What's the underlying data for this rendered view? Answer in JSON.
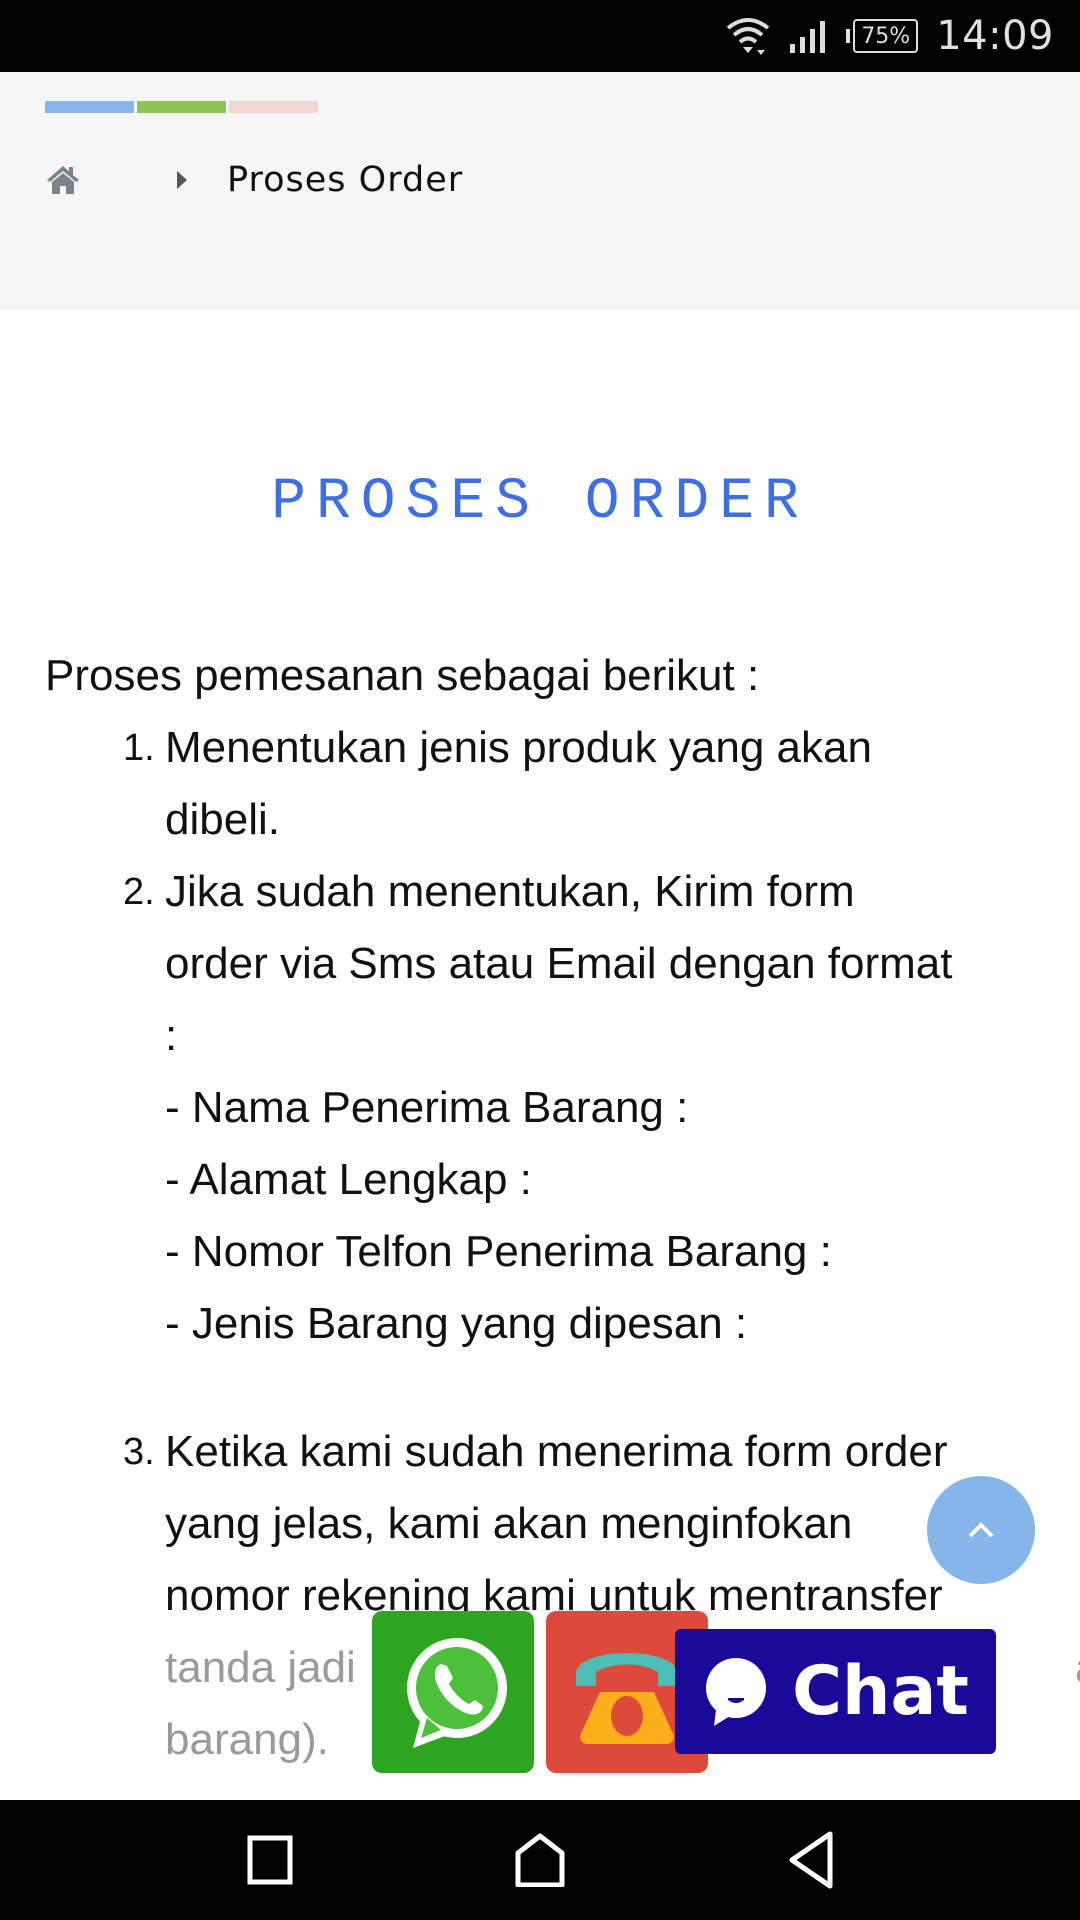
{
  "status_bar": {
    "time": "14:09",
    "battery_percent": "75%",
    "icons": [
      "wifi-icon",
      "signal-icon",
      "battery-icon"
    ]
  },
  "header": {
    "color_bars": [
      "#85b8ea",
      "#8dc453",
      "#f1d6d2"
    ],
    "breadcrumb": {
      "home_icon": "home-icon",
      "separator_icon": "caret-right-icon",
      "current": "Proses Order"
    }
  },
  "page": {
    "title": "PROSES ORDER",
    "title_color": "#3e6fe4",
    "intro": "Proses pemesanan sebagai berikut :",
    "steps": [
      {
        "number": "1.",
        "lines": [
          "Menentukan jenis produk yang akan",
          "dibeli."
        ]
      },
      {
        "number": "2.",
        "lines": [
          "Jika sudah menentukan, Kirim form",
          "order via Sms atau Email dengan format",
          ":"
        ],
        "format_fields": [
          "- Nama Penerima Barang :",
          "- Alamat Lengkap :",
          "- Nomor Telfon Penerima Barang :",
          "- Jenis Barang yang dipesan :"
        ]
      },
      {
        "number": "3.",
        "lines": [
          "Ketika kami sudah menerima form order",
          "yang jelas, kami akan menginfokan",
          "nomor rekening kami untuk mentransfer"
        ],
        "faded_lines": [
          "tanda jadi",
          "barang)."
        ],
        "faded_fragments": [
          "a",
          "a"
        ]
      }
    ]
  },
  "floating": {
    "scroll_top_icon": "chevron-up-icon",
    "whatsapp_icon": "whatsapp-icon",
    "phone_icon": "telephone-icon",
    "chat_label": "Chat",
    "chat_icon": "chat-bubble-icon",
    "colors": {
      "scroll_top": "#85b5e9",
      "whatsapp": "#2da521",
      "phone": "#de4a39",
      "chat": "#1a0a9a"
    }
  },
  "nav_bar": {
    "buttons": [
      "recents-icon",
      "home-icon",
      "back-icon"
    ]
  }
}
